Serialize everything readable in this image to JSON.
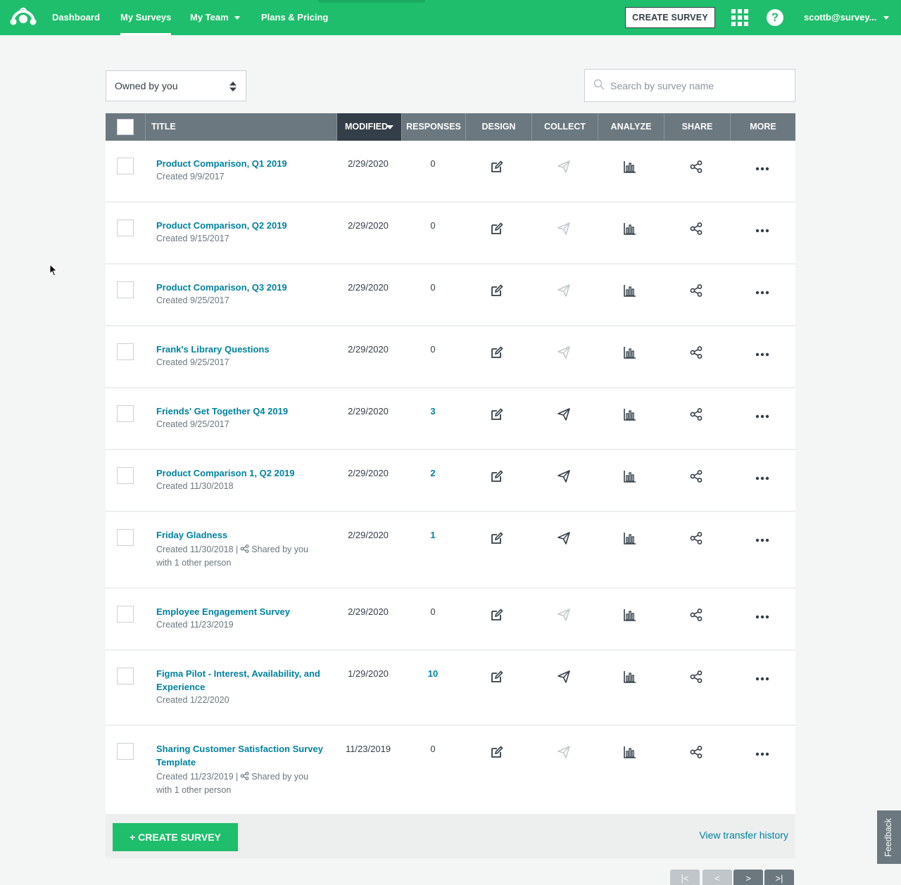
{
  "nav": {
    "links": [
      "Dashboard",
      "My Surveys",
      "My Team",
      "Plans & Pricing"
    ],
    "create_label": "CREATE SURVEY",
    "help_glyph": "?",
    "user": "scottb@survey...",
    "brand_color": "#1fbe6c"
  },
  "filter": {
    "owner": "Owned by you"
  },
  "search": {
    "placeholder": "Search by survey name"
  },
  "columns": [
    "TITLE",
    "MODIFIED",
    "RESPONSES",
    "DESIGN",
    "COLLECT",
    "ANALYZE",
    "SHARE",
    "MORE"
  ],
  "surveys": [
    {
      "title": "Product Comparison, Q1 2019",
      "created": "Created 9/9/2017",
      "modified": "2/29/2020",
      "responses": "0"
    },
    {
      "title": "Product Comparison, Q2 2019",
      "created": "Created 9/15/2017",
      "modified": "2/29/2020",
      "responses": "0"
    },
    {
      "title": "Product Comparison, Q3 2019",
      "created": "Created 9/25/2017",
      "modified": "2/29/2020",
      "responses": "0"
    },
    {
      "title": "Frank's Library Questions",
      "created": "Created 9/25/2017",
      "modified": "2/29/2020",
      "responses": "0"
    },
    {
      "title": "Friends' Get Together Q4 2019",
      "created": "Created 9/25/2017",
      "modified": "2/29/2020",
      "responses": "3"
    },
    {
      "title": "Product Comparison 1, Q2 2019",
      "created": "Created 11/30/2018",
      "modified": "2/29/2020",
      "responses": "2"
    },
    {
      "title": "Friday Gladness",
      "created": "Created 11/30/2018 |",
      "shared": "Shared by you",
      "shared_with": "with 1 other person",
      "modified": "2/29/2020",
      "responses": "1"
    },
    {
      "title": "Employee Engagement Survey",
      "created": "Created 11/23/2019",
      "modified": "2/29/2020",
      "responses": "0"
    },
    {
      "title": "Figma Pilot - Interest, Availability, and Experience",
      "created": "Created 1/22/2020",
      "modified": "1/29/2020",
      "responses": "10"
    },
    {
      "title": "Sharing Customer Satisfaction Survey Template",
      "created": "Created 11/23/2019 |",
      "shared": "Shared by you",
      "shared_with": "with 1 other person",
      "modified": "11/23/2019",
      "responses": "0"
    }
  ],
  "footer": {
    "create_label": "+ CREATE SURVEY",
    "transfer_label": "View transfer history"
  },
  "pagination": [
    "|<",
    "<",
    ">",
    ">|"
  ],
  "feedback_label": "Feedback",
  "icons": {
    "design": "edit-icon",
    "collect": "send-icon",
    "analyze": "bar-chart-icon",
    "share": "share-icon",
    "more": "more-dots-icon"
  }
}
